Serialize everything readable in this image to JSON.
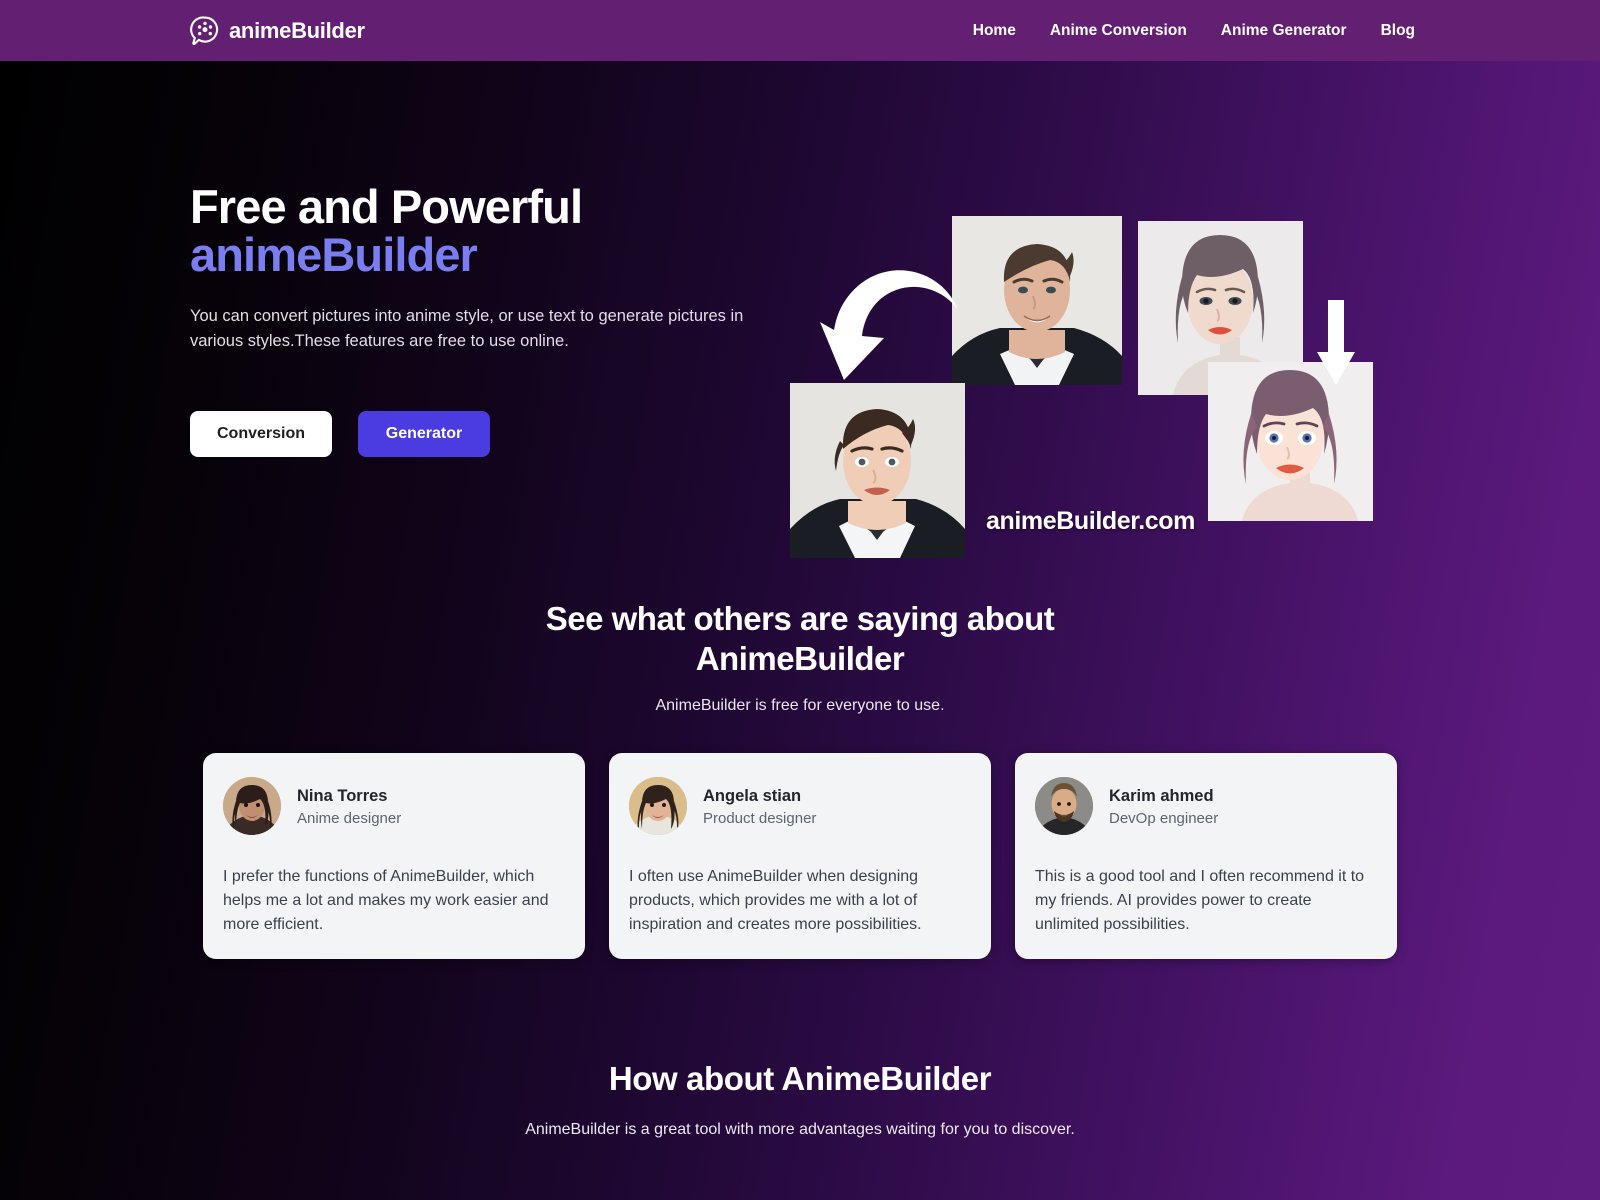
{
  "header": {
    "logo_icon": "film-reel-chat-icon",
    "brand": "animeBuilder",
    "brand_bg": "#632073",
    "nav": [
      {
        "label": "Home"
      },
      {
        "label": "Anime Conversion"
      },
      {
        "label": "Anime Generator"
      },
      {
        "label": "Blog"
      }
    ]
  },
  "hero": {
    "title_line1": "Free and Powerful",
    "title_line2": "animeBuilder",
    "accent_color": "#7b7ef0",
    "subtitle": "You can convert pictures into anime style, or use text to generate pictures in various styles.These features are free to use online.",
    "buttons": {
      "conversion": "Conversion",
      "generator": "Generator",
      "generator_color": "#4a3ce0"
    },
    "collage": {
      "watermark": "animeBuilder.com",
      "photos": [
        {
          "name": "source-portrait-man",
          "alt": "photo of a man in a suit"
        },
        {
          "name": "source-portrait-woman",
          "alt": "photo of a woman"
        },
        {
          "name": "anime-portrait-man",
          "alt": "anime styled man"
        },
        {
          "name": "anime-portrait-woman",
          "alt": "anime styled woman"
        }
      ],
      "arrows": [
        "curved-arrow-icon",
        "down-arrow-icon"
      ]
    }
  },
  "testimonials": {
    "title_line1": "See what others are saying about",
    "title_line2": "AnimeBuilder",
    "subtitle": "AnimeBuilder is free for everyone to use.",
    "cards": [
      {
        "name": "Nina Torres",
        "role": "Anime designer",
        "quote": "I prefer the functions of AnimeBuilder, which helps me a lot and makes my work easier and more efficient.",
        "avatar": "avatar-nina"
      },
      {
        "name": "Angela stian",
        "role": "Product designer",
        "quote": "I often use AnimeBuilder when designing products, which provides me with a lot of inspiration and creates more possibilities.",
        "avatar": "avatar-angela"
      },
      {
        "name": "Karim ahmed",
        "role": "DevOp engineer",
        "quote": "This is a good tool and I often recommend it to my friends. AI provides power to create unlimited possibilities.",
        "avatar": "avatar-karim"
      }
    ]
  },
  "about": {
    "title": "How about AnimeBuilder",
    "subtitle": "AnimeBuilder is a great tool with more advantages waiting for you to discover."
  }
}
